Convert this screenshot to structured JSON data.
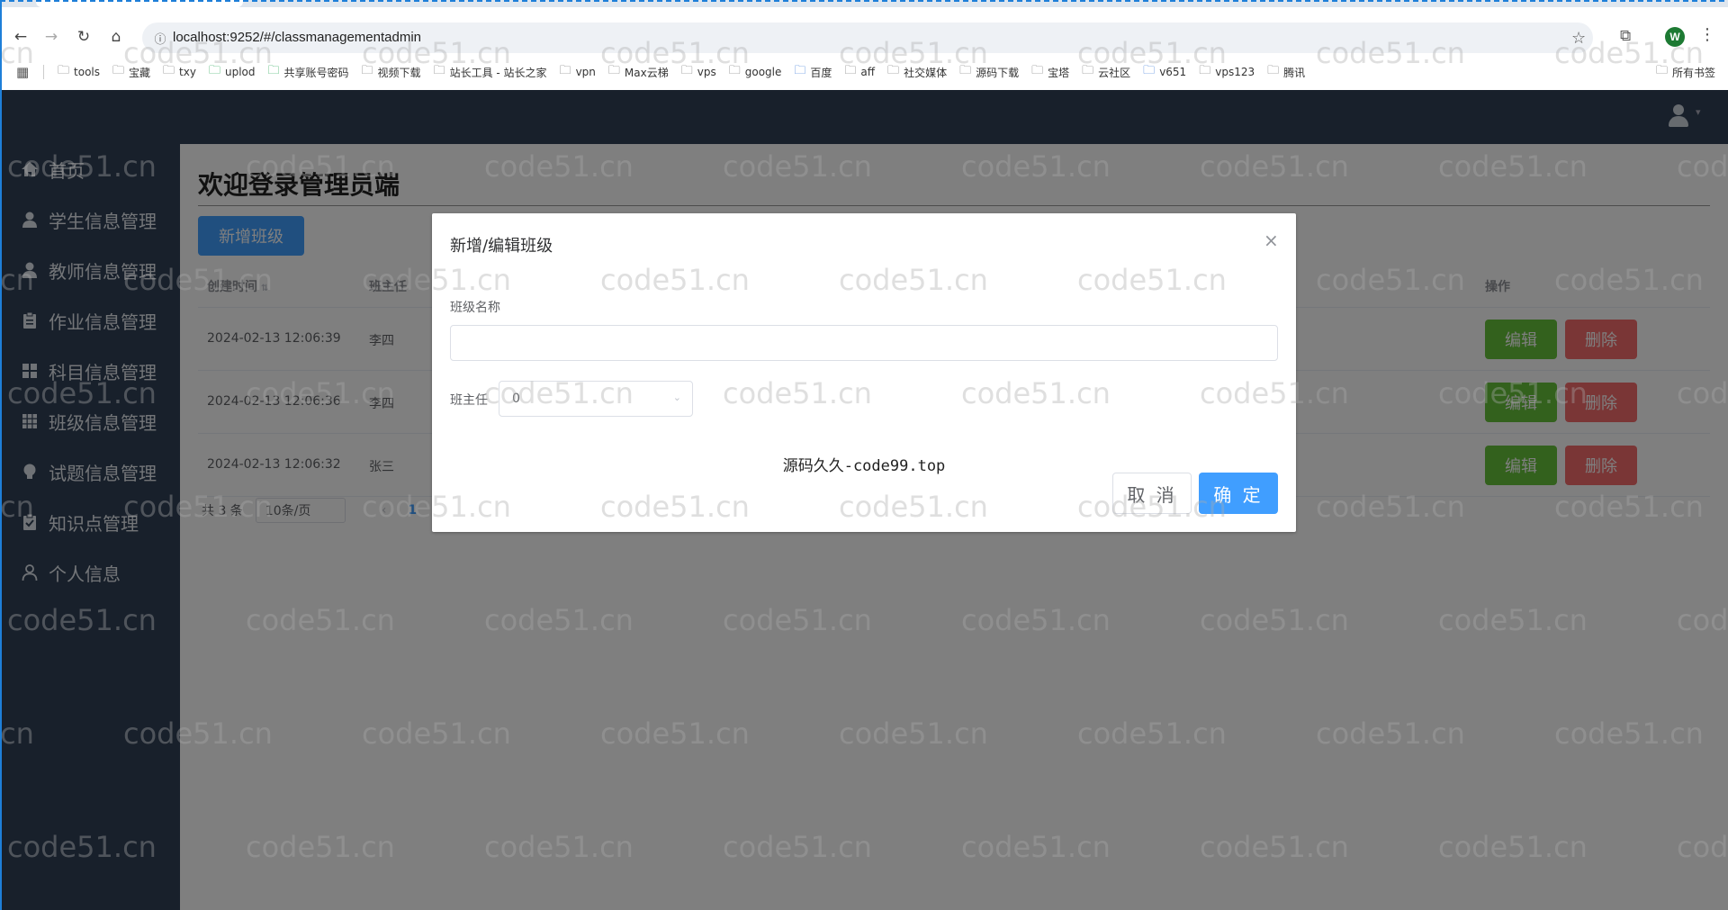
{
  "browser": {
    "url": "localhost:9252/#/classmanagementadmin",
    "profile_initial": "W",
    "bookmarks": [
      "tools",
      "宝藏",
      "txy",
      "uplod",
      "共享账号密码",
      "视频下载",
      "站长工具 - 站长之家",
      "vpn",
      "Max云梯",
      "vps",
      "google",
      "百度",
      "aff",
      "社交媒体",
      "源码下载",
      "宝塔",
      "云社区",
      "v651",
      "vps123",
      "腾讯"
    ],
    "all_bookmarks_label": "所有书签"
  },
  "sidebar": {
    "items": [
      {
        "label": "首页",
        "icon": "home-icon"
      },
      {
        "label": "学生信息管理",
        "icon": "user-icon"
      },
      {
        "label": "教师信息管理",
        "icon": "user-icon"
      },
      {
        "label": "作业信息管理",
        "icon": "clipboard-icon"
      },
      {
        "label": "科目信息管理",
        "icon": "grid-icon"
      },
      {
        "label": "班级信息管理",
        "icon": "grid-icon"
      },
      {
        "label": "试题信息管理",
        "icon": "lightbulb-icon"
      },
      {
        "label": "知识点管理",
        "icon": "checklist-icon"
      },
      {
        "label": "个人信息",
        "icon": "user-outline-icon"
      }
    ]
  },
  "main": {
    "title": "欢迎登录管理员端",
    "add_button": "新增班级",
    "table": {
      "headers": {
        "created": "创建时间",
        "teacher": "班主任",
        "actions": "操作"
      },
      "rows": [
        {
          "created": "2024-02-13 12:06:39",
          "teacher": "李四"
        },
        {
          "created": "2024-02-13 12:06:36",
          "teacher": "李四"
        },
        {
          "created": "2024-02-13 12:06:32",
          "teacher": "张三"
        }
      ],
      "edit_label": "编辑",
      "delete_label": "删除"
    },
    "pagination": {
      "total": "共 3 条",
      "page_size": "10条/页",
      "prev": "‹",
      "current_page": "1"
    }
  },
  "dialog": {
    "title": "新增/编辑班级",
    "close": "×",
    "class_name_label": "班级名称",
    "class_name_value": "",
    "teacher_label": "班主任",
    "teacher_value": "0",
    "footer_text": "源码久久-code99.top",
    "cancel": "取 消",
    "confirm": "确 定"
  },
  "watermark": "code51.cn",
  "colors": {
    "primary": "#409eff",
    "success": "#67c23a",
    "danger": "#f56c6c",
    "sidebar": "#304156"
  }
}
